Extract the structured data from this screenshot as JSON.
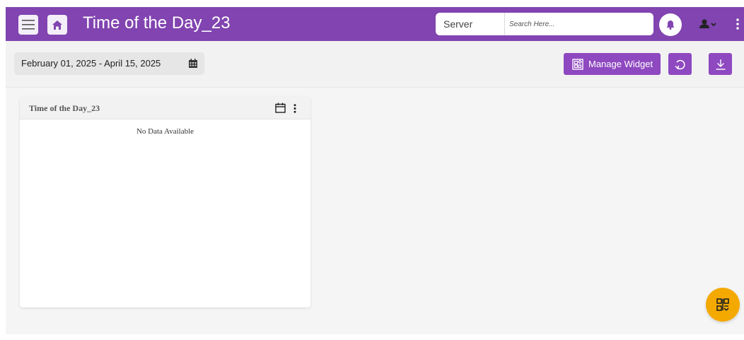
{
  "header": {
    "title": "Time of the Day_23",
    "server_label": "Server",
    "search_placeholder": "Search Here..."
  },
  "toolbar": {
    "date_range": "February 01, 2025 - April 15, 2025",
    "manage_widget_label": "Manage Widget"
  },
  "widget": {
    "title": "Time of the Day_23",
    "empty_message": "No Data Available"
  },
  "icons": {
    "menu": "hamburger-icon",
    "home": "home-icon",
    "bell": "bell-icon",
    "user": "user-icon",
    "more": "kebab-icon",
    "calendar": "calendar-icon",
    "widget": "widget-icon",
    "reset": "reset-icon",
    "download": "download-icon",
    "qr": "qr-icon"
  },
  "colors": {
    "header": "#8144b0",
    "accent": "#8e48c0",
    "fab": "#f4a900"
  }
}
